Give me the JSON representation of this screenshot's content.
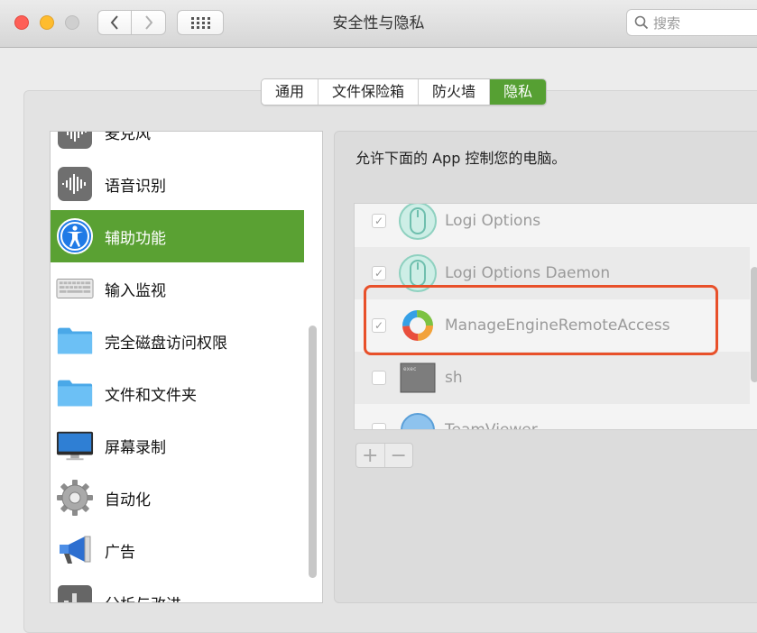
{
  "window": {
    "title": "安全性与隐私",
    "search_placeholder": "搜索"
  },
  "tabs": [
    {
      "label": "通用",
      "active": false
    },
    {
      "label": "文件保险箱",
      "active": false
    },
    {
      "label": "防火墙",
      "active": false
    },
    {
      "label": "隐私",
      "active": true
    }
  ],
  "categories": [
    {
      "label": "麦克风",
      "icon": "microphone-icon"
    },
    {
      "label": "语音识别",
      "icon": "speech-waveform-icon"
    },
    {
      "label": "辅助功能",
      "icon": "accessibility-icon",
      "selected": true
    },
    {
      "label": "输入监视",
      "icon": "keyboard-icon"
    },
    {
      "label": "完全磁盘访问权限",
      "icon": "folder-icon"
    },
    {
      "label": "文件和文件夹",
      "icon": "folder-icon"
    },
    {
      "label": "屏幕录制",
      "icon": "display-icon"
    },
    {
      "label": "自动化",
      "icon": "gear-icon"
    },
    {
      "label": "广告",
      "icon": "megaphone-icon"
    },
    {
      "label": "分析与改进",
      "icon": "chart-icon"
    }
  ],
  "content": {
    "allow_text": "允许下面的 App 控制您的电脑。",
    "apps": [
      {
        "name": "Logi Options",
        "checked": true,
        "icon": "mouse-icon"
      },
      {
        "name": "Logi Options Daemon",
        "checked": true,
        "icon": "mouse-icon"
      },
      {
        "name": "ManageEngineRemoteAccess",
        "checked": true,
        "icon": "remote-access-icon"
      },
      {
        "name": "sh",
        "checked": false,
        "icon": "terminal-icon",
        "icon_text": "exec"
      },
      {
        "name": "TeamViewer",
        "checked": false,
        "icon": "teamviewer-icon"
      }
    ],
    "add_label": "+",
    "remove_label": "−"
  },
  "colors": {
    "accent_green": "#5aa133",
    "highlight_red": "#e8502a"
  }
}
